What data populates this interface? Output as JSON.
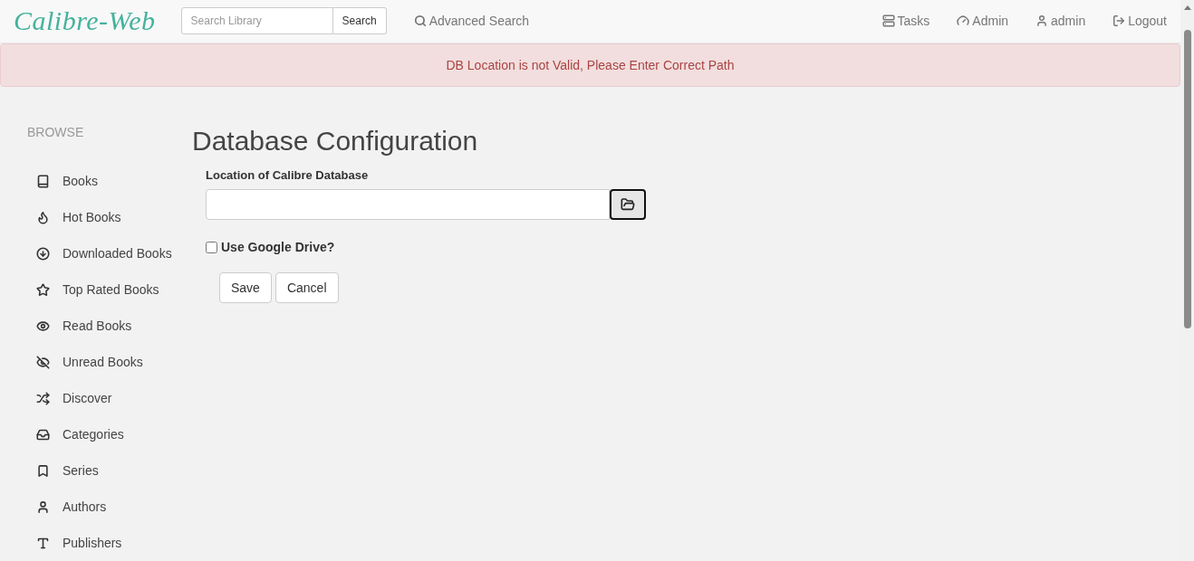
{
  "navbar": {
    "logo": "Calibre-Web",
    "search": {
      "placeholder": "Search Library",
      "button": "Search"
    },
    "advanced_search": "Advanced Search",
    "right_links": [
      {
        "label": "Tasks"
      },
      {
        "label": "Admin"
      },
      {
        "label": "admin"
      },
      {
        "label": "Logout"
      }
    ]
  },
  "alert": "DB Location is not Valid, Please Enter Correct Path",
  "sidebar": {
    "heading": "BROWSE",
    "items": [
      {
        "label": "Books"
      },
      {
        "label": "Hot Books"
      },
      {
        "label": "Downloaded Books"
      },
      {
        "label": "Top Rated Books"
      },
      {
        "label": "Read Books"
      },
      {
        "label": "Unread Books"
      },
      {
        "label": "Discover"
      },
      {
        "label": "Categories"
      },
      {
        "label": "Series"
      },
      {
        "label": "Authors"
      },
      {
        "label": "Publishers"
      }
    ]
  },
  "form": {
    "title": "Database Configuration",
    "location_label": "Location of Calibre Database",
    "google_drive": {
      "label": "Use Google Drive?",
      "checked": false
    },
    "buttons": [
      "Save",
      "Cancel"
    ]
  }
}
